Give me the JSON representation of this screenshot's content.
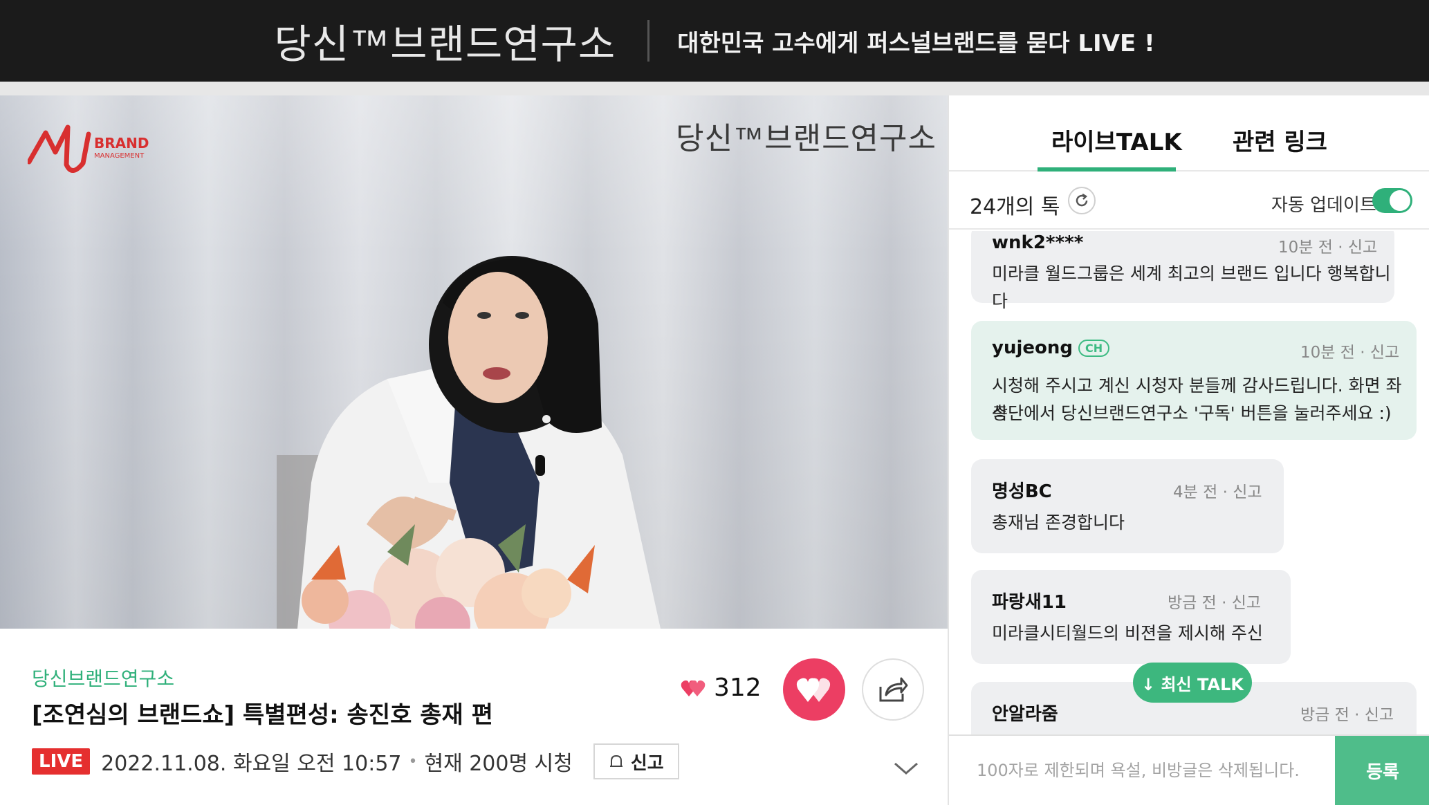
{
  "banner": {
    "logo_text": "당신™브랜드연구소",
    "tagline": "대한민국 고수에게 퍼스널브랜드를 묻다 LIVE !"
  },
  "video": {
    "channel_logo": {
      "brand": "BRAND",
      "sub": "MANAGEMENT"
    },
    "watermark": "당신™브랜드연구소"
  },
  "info": {
    "channel_name": "당신브랜드연구소",
    "title": "[조연심의 브랜드쇼] 특별편성: 송진호 총재 편",
    "live_badge": "LIVE",
    "datetime": "2022.11.08. 화요일 오전 10:57",
    "viewers": "현재 200명 시청",
    "report_label": "신고",
    "like_count": "312"
  },
  "panel": {
    "tabs": [
      {
        "label": "라이브TALK",
        "active": true
      },
      {
        "label": "관련 링크",
        "active": false
      }
    ],
    "talk_count": "24개의 톡",
    "auto_update_label": "자동 업데이트",
    "auto_update_on": true,
    "messages": [
      {
        "user": "wnk2****",
        "time": "10분 전",
        "report": "신고",
        "text": [
          "미라클 월드그룹은 세계 최고의 브랜드 입니다 행복합니다"
        ],
        "channel": false
      },
      {
        "user": "yujeong",
        "badge": "CH",
        "time": "10분 전",
        "report": "신고",
        "text": [
          "시청해 주시고 계신 시청자 분들께 감사드립니다. 화면 좌측",
          "상단에서 당신브랜드연구소 '구독' 버튼을 눌러주세요 :)"
        ],
        "channel": true
      },
      {
        "user": "명성BC",
        "time": "4분 전",
        "report": "신고",
        "text": [
          "총재님 존경합니다"
        ],
        "channel": false
      },
      {
        "user": "파랑새11",
        "time": "방금 전",
        "report": "신고",
        "text": [
          "미라클시티월드의 비젼을 제시해 주신"
        ],
        "channel": false
      },
      {
        "user": "안알라줌",
        "time": "방금 전",
        "report": "신고",
        "text": [],
        "channel": false
      }
    ],
    "newest_button": "↓ 최신 TALK",
    "input_placeholder": "100자로 제한되며 욕설, 비방글은 삭제됩니다.",
    "submit_label": "등록"
  },
  "colors": {
    "accent_green": "#2fb07a",
    "live_red": "#e52f2f",
    "like_pink": "#ec3e63",
    "banner_bg": "#1b1b1b"
  }
}
